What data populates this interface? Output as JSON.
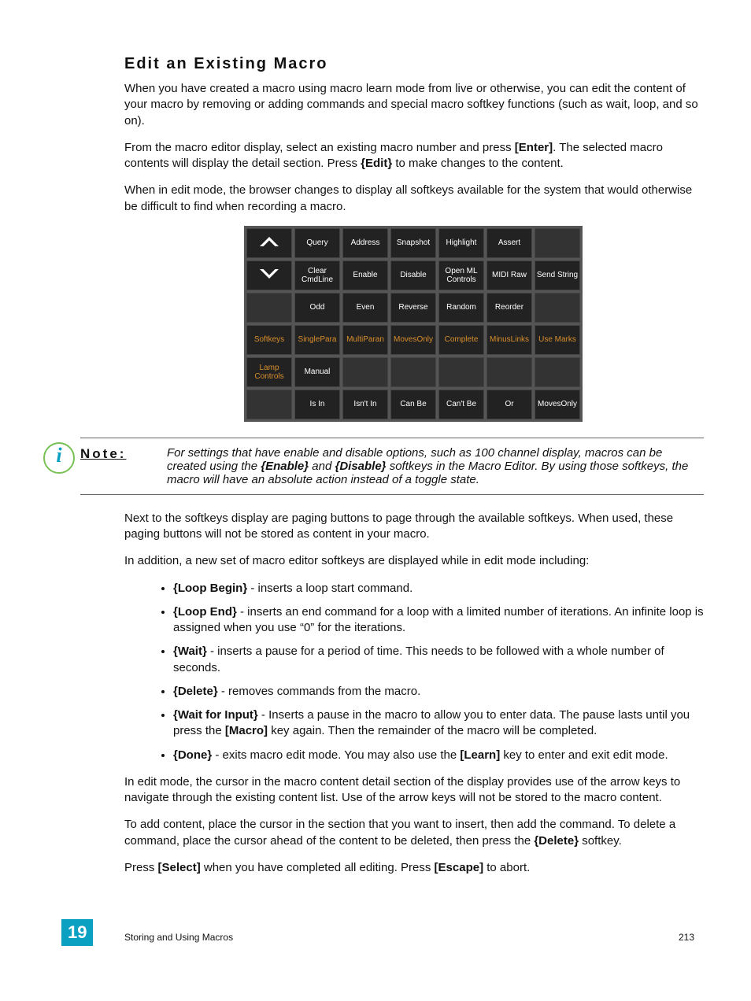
{
  "title": "Edit an Existing Macro",
  "paragraphs": {
    "p1": "When you have created a macro using macro learn mode from live or otherwise, you can edit the content of your macro by removing or adding commands and special macro softkey functions (such as wait, loop, and so on).",
    "p2a": "From the macro editor display, select an existing macro number and press ",
    "p2b": "[Enter]",
    "p2c": ". The selected macro contents will display the detail section. Press ",
    "p2d": "{Edit}",
    "p2e": " to make changes to the content.",
    "p3": "When in edit mode, the browser changes to display all softkeys available for the system that would otherwise be difficult to find when recording a macro."
  },
  "softkeys": [
    [
      "__up",
      "Query",
      "Address",
      "Snapshot",
      "Highlight",
      "Assert",
      ""
    ],
    [
      "__down",
      "Clear CmdLine",
      "Enable",
      "Disable",
      "Open ML Controls",
      "MIDI Raw",
      "Send String"
    ],
    [
      "",
      "Odd",
      "Even",
      "Reverse",
      "Random",
      "Reorder",
      ""
    ],
    [
      "Softkeys|sel",
      "SinglePara|sel",
      "MultiParan|sel",
      "MovesOnly|sel",
      "Complete|sel",
      "MinusLinks|sel",
      "Use Marks|sel"
    ],
    [
      "Lamp Controls|sel",
      "Manual",
      "",
      "",
      "",
      "",
      ""
    ],
    [
      "",
      "Is In",
      "Isn't In",
      "Can Be",
      "Can't Be",
      "Or",
      "MovesOnly"
    ]
  ],
  "note": {
    "label": "Note:",
    "body_a": "For settings that have enable and disable options, such as 100 channel display, macros can be created using the ",
    "body_b": "{Enable}",
    "body_c": " and ",
    "body_d": "{Disable}",
    "body_e": " softkeys in the Macro Editor. By using those softkeys, the macro will have an absolute action instead of a toggle state."
  },
  "after": {
    "p1": "Next to the softkeys display are paging buttons to page through the available softkeys. When used, these paging buttons will not be stored as content in your macro.",
    "p2": "In addition, a new set of macro editor softkeys are displayed while in edit mode including:"
  },
  "bullets": [
    {
      "k": "{Loop Begin}",
      "t": " - inserts a loop start command."
    },
    {
      "k": "{Loop End}",
      "t": " - inserts an end command for a loop with a limited number of iterations. An infinite loop is assigned when you use “0” for the iterations."
    },
    {
      "k": "{Wait}",
      "t": " - inserts a pause for a period of time. This needs to be followed with a whole number of seconds."
    },
    {
      "k": "{Delete}",
      "t": " - removes commands from the macro."
    },
    {
      "k": "{Wait for Input}",
      "t": " - Inserts a pause in the macro to allow you to enter data. The pause lasts until you press the ",
      "k2": "[Macro]",
      "t2": " key again. Then the remainder of the macro will be completed."
    },
    {
      "k": "{Done}",
      "t": " - exits macro edit mode. You may also use the ",
      "k2": "[Learn]",
      "t2": " key to enter and exit edit mode."
    }
  ],
  "tail": {
    "p1": "In edit mode, the cursor in the macro content detail section of the display provides use of the arrow keys to navigate through the existing content list. Use of the arrow keys will not be stored to the macro content.",
    "p2a": "To add content, place the cursor in the section that you want to insert, then add the command. To delete a command, place the cursor ahead of the content to be deleted, then press the ",
    "p2b": "{Delete}",
    "p2c": " softkey.",
    "p3a": "Press ",
    "p3b": "[Select]",
    "p3c": " when you have completed all editing. Press ",
    "p3d": "[Escape]",
    "p3e": " to abort."
  },
  "footer": {
    "chapter": "19",
    "text": "Storing and Using Macros",
    "page": "213"
  }
}
